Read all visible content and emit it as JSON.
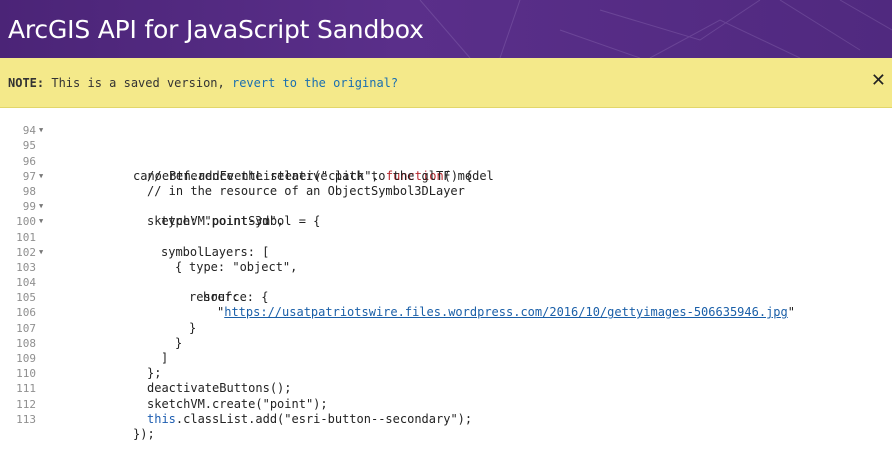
{
  "header": {
    "title": "ArcGIS API for JavaScript Sandbox"
  },
  "note": {
    "label": "NOTE:",
    "text": " This is a saved version, ",
    "link": "revert to the original?",
    "close_icon": "close-icon"
  },
  "editor": {
    "lines": [
      {
        "num": "94",
        "fold": false
      },
      {
        "num": "95",
        "fold": true
      },
      {
        "num": "96",
        "fold": false
      },
      {
        "num": "97",
        "fold": false
      },
      {
        "num": "98",
        "fold": true
      },
      {
        "num": "99",
        "fold": false
      },
      {
        "num": "100",
        "fold": true
      },
      {
        "num": "101",
        "fold": true
      },
      {
        "num": "102",
        "fold": false
      },
      {
        "num": "103",
        "fold": true
      },
      {
        "num": "104",
        "fold": false
      },
      {
        "num": "105",
        "fold": false
      },
      {
        "num": "106",
        "fold": false
      },
      {
        "num": "107",
        "fold": false
      },
      {
        "num": "108",
        "fold": false
      },
      {
        "num": "109",
        "fold": false
      },
      {
        "num": "110",
        "fold": false
      },
      {
        "num": "111",
        "fold": false
      },
      {
        "num": "112",
        "fold": false
      },
      {
        "num": "113",
        "fold": false
      }
    ],
    "code": {
      "l95a": "canoeBtn.addEventListener(\"click\", ",
      "l95kw": "function",
      "l95b": "() {",
      "l96": "// reference the relative path to the glTF model",
      "l97": "// in the resource of an ObjectSymbol3DLayer",
      "l98": "sketchVM.pointSymbol = {",
      "l99": "type: \"point-3d\",",
      "l100": "symbolLayers: [",
      "l101": "{",
      "l102": "type: \"object\",",
      "l103": "resource: {",
      "l104": "href:",
      "l105q1": "\"",
      "l105url": "https://usatpatriotswire.files.wordpress.com/2016/10/gettyimages-506635946.jpg",
      "l105q2": "\"",
      "l106": "}",
      "l107": "}",
      "l108": "]",
      "l109": "};",
      "l110": "deactivateButtons();",
      "l111": "sketchVM.create(\"point\");",
      "l112kw": "this",
      "l112b": ".classList.add(\"esri-button--secondary\");",
      "l113": "});"
    }
  }
}
